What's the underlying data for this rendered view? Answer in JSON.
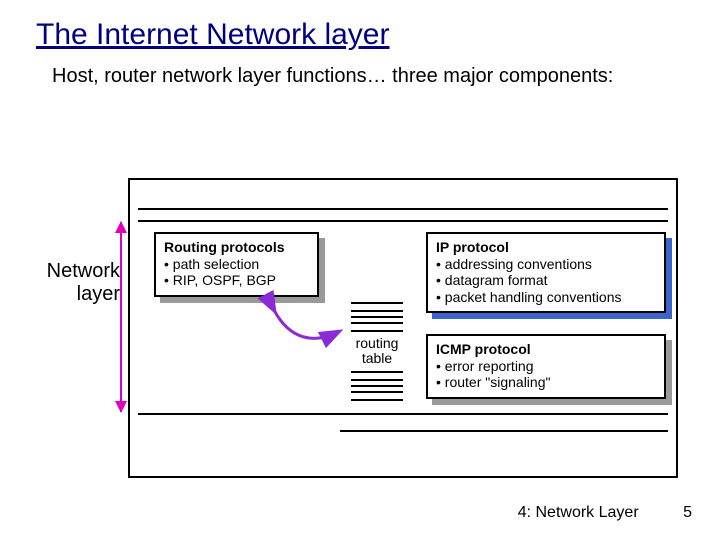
{
  "title": "The Internet Network layer",
  "subtitle": "Host, router network layer functions… three major components:",
  "side_label_1": "Network",
  "side_label_2": "layer",
  "routing": {
    "header": "Routing protocols",
    "b1": "path selection",
    "b2": "RIP, OSPF, BGP"
  },
  "ip": {
    "header": "IP protocol",
    "b1": "addressing conventions",
    "b2": "datagram format",
    "b3": "packet handling conventions"
  },
  "icmp": {
    "header": "ICMP protocol",
    "b1": "error reporting",
    "b2": "router \"signaling\""
  },
  "table_label_1": "routing",
  "table_label_2": "table",
  "footer": {
    "chapter": "4: Network Layer",
    "page": "5"
  }
}
